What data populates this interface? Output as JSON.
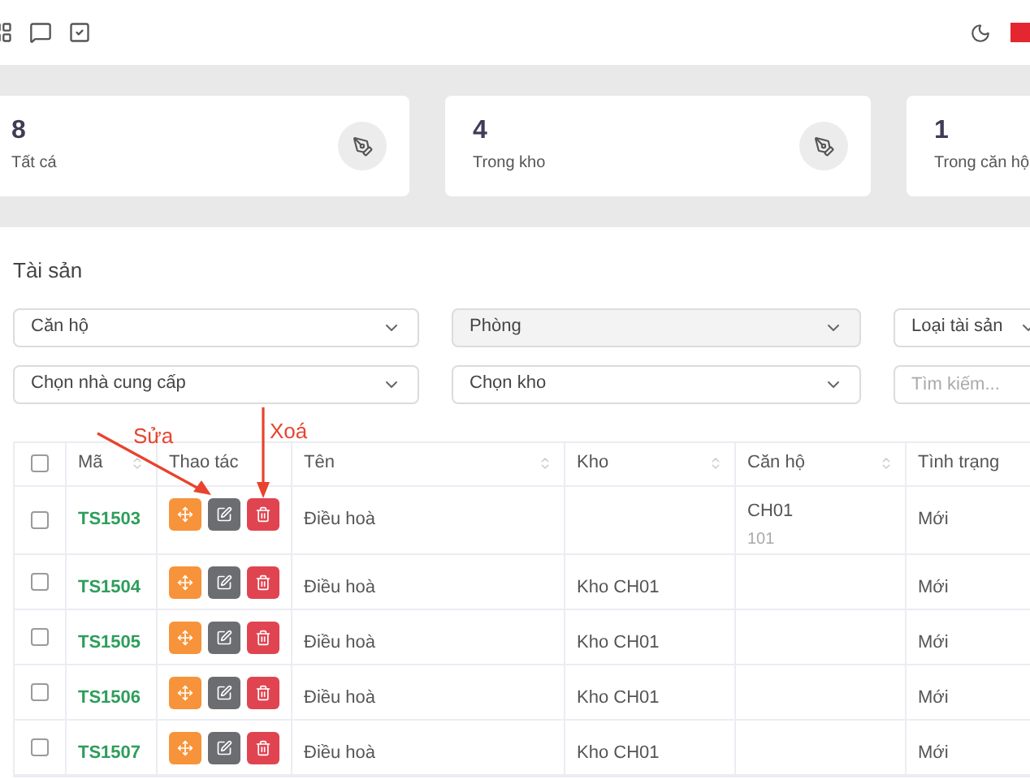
{
  "stats": [
    {
      "value": "8",
      "label": "Tất cá"
    },
    {
      "value": "4",
      "label": "Trong kho"
    },
    {
      "value": "1",
      "label": "Trong căn hộ"
    }
  ],
  "section_title": "Tài sản",
  "filters": [
    {
      "kind": "select",
      "text": "Căn hộ",
      "disabled": false
    },
    {
      "kind": "select",
      "text": "Phòng",
      "disabled": true
    },
    {
      "kind": "select",
      "text": "Loại tài sản",
      "disabled": false
    },
    {
      "kind": "select",
      "text": "Chọn nhà cung cấp",
      "disabled": false
    },
    {
      "kind": "select",
      "text": "Chọn kho",
      "disabled": false
    },
    {
      "kind": "search",
      "placeholder": "Tìm kiếm..."
    }
  ],
  "table": {
    "select_all": {
      "checked": false
    },
    "columns": [
      {
        "label": "Mã",
        "sortable": true
      },
      {
        "label": "Thao tác",
        "sortable": false
      },
      {
        "label": "Tên",
        "sortable": true
      },
      {
        "label": "Kho",
        "sortable": true
      },
      {
        "label": "Căn hộ",
        "sortable": true
      },
      {
        "label": "Tình trạng",
        "sortable": false
      }
    ],
    "rows": [
      {
        "checked": false,
        "code": "TS1503",
        "name": "Điều hoà",
        "warehouse": "",
        "apartment": "CH01",
        "room": "101",
        "status": "Mới"
      },
      {
        "checked": false,
        "code": "TS1504",
        "name": "Điều hoà",
        "warehouse": "Kho CH01",
        "apartment": "",
        "room": "",
        "status": "Mới"
      },
      {
        "checked": false,
        "code": "TS1505",
        "name": "Điều hoà",
        "warehouse": "Kho CH01",
        "apartment": "",
        "room": "",
        "status": "Mới"
      },
      {
        "checked": false,
        "code": "TS1506",
        "name": "Điều hoà",
        "warehouse": "Kho CH01",
        "apartment": "",
        "room": "",
        "status": "Mới"
      },
      {
        "checked": false,
        "code": "TS1507",
        "name": "Điều hoà",
        "warehouse": "Kho CH01",
        "apartment": "",
        "room": "",
        "status": "Mới"
      }
    ]
  },
  "annotations": [
    {
      "kind": "edit",
      "text": "Sửa"
    },
    {
      "kind": "delete",
      "text": "Xoá"
    }
  ]
}
